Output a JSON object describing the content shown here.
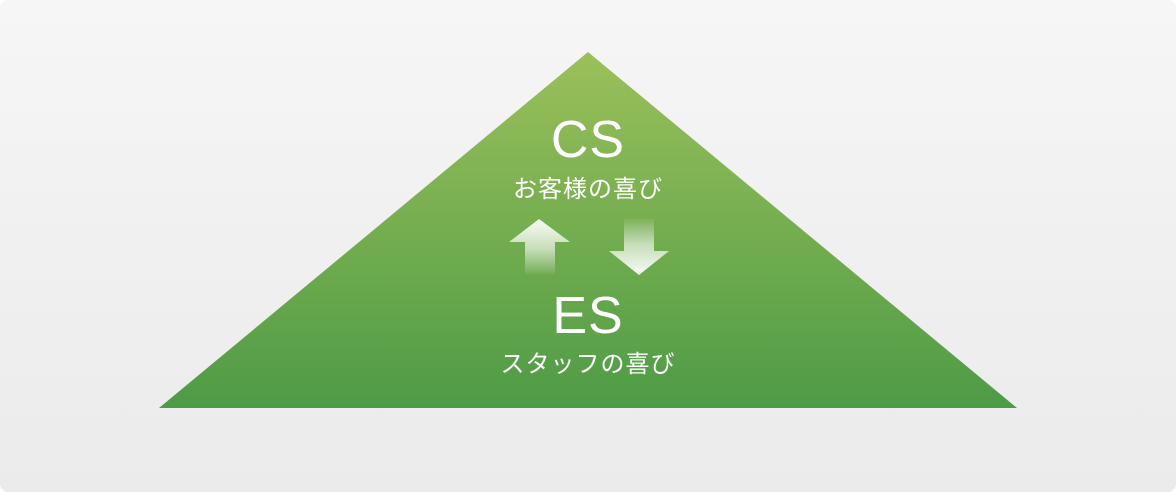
{
  "cs": {
    "title": "CS",
    "subtitle": "お客様の喜び"
  },
  "es": {
    "title": "ES",
    "subtitle": "スタッフの喜び"
  },
  "arrows": [
    "up-arrow",
    "down-arrow"
  ],
  "colors": {
    "triangle_top": "#9bc05a",
    "triangle_bottom": "#4e9b46",
    "background": "#f2f2f2",
    "text": "#ffffff"
  }
}
